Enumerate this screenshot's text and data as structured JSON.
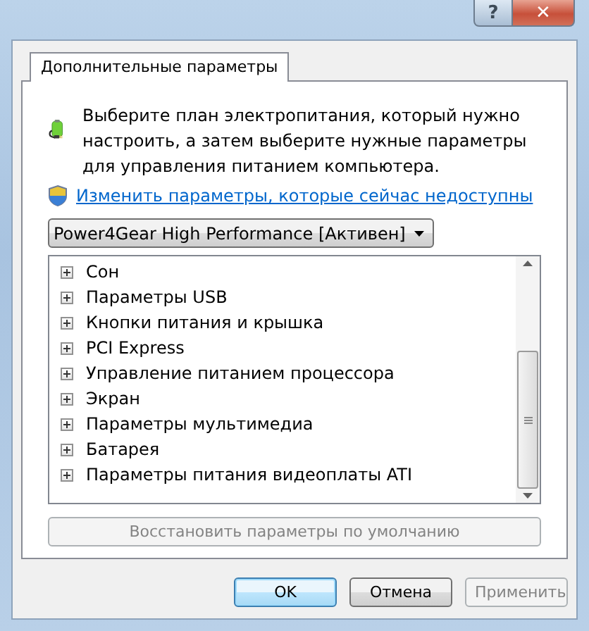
{
  "window": {
    "help_button": "?",
    "close_button": "✕"
  },
  "tabs": [
    {
      "label": "Дополнительные параметры",
      "selected": true
    }
  ],
  "description": "Выберите план электропитания, который нужно настроить, а затем выберите нужные параметры для управления питанием компьютера.",
  "admin_link": "Изменить параметры, которые сейчас недоступны",
  "plan_dropdown": {
    "value": "Power4Gear High Performance [Активен]"
  },
  "settings_tree": [
    {
      "label": "Сон",
      "expanded": false
    },
    {
      "label": "Параметры USB",
      "expanded": false
    },
    {
      "label": "Кнопки питания и крышка",
      "expanded": false
    },
    {
      "label": "PCI Express",
      "expanded": false
    },
    {
      "label": "Управление питанием процессора",
      "expanded": false
    },
    {
      "label": "Экран",
      "expanded": false
    },
    {
      "label": "Параметры мультимедиа",
      "expanded": false
    },
    {
      "label": "Батарея",
      "expanded": false
    },
    {
      "label": "Параметры питания видеоплаты ATI",
      "expanded": false
    }
  ],
  "restore_button": {
    "label": "Восстановить параметры по умолчанию",
    "disabled": true
  },
  "buttons": [
    {
      "label": "OK",
      "kind": "default",
      "disabled": false
    },
    {
      "label": "Отмена",
      "kind": "normal",
      "disabled": false
    },
    {
      "label": "Применить",
      "kind": "normal",
      "disabled": true
    }
  ]
}
